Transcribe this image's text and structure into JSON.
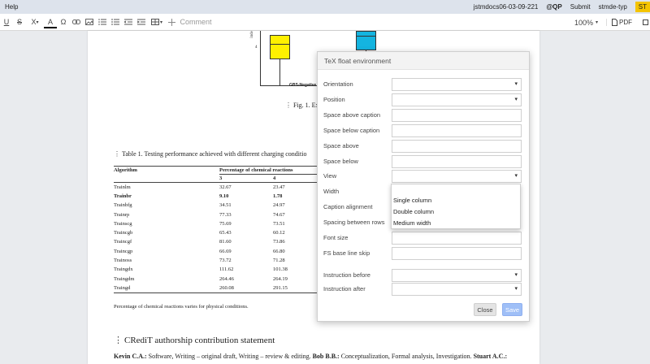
{
  "menubar": {
    "help": "Help",
    "doc_id": "jstmdocs06-03-09-221",
    "user": "@QP",
    "submit": "Submit",
    "template": "stmde-typ",
    "badge": "ST"
  },
  "toolbar": {
    "underline": "U",
    "strike": "S",
    "subsup": "X",
    "textcolor": "A",
    "special": "Ω",
    "comment": "Comment",
    "zoom": "100%",
    "pdf": "PDF"
  },
  "figure": {
    "y_axis_label": "inde",
    "y_tick": "4",
    "x_tick": "GBS-Negative",
    "caption": "Fig. 1. Ex"
  },
  "table": {
    "caption": "Table 1. Testing performance achieved with different charging conditio",
    "header_col1": "Algorithm",
    "header_group": "Percentage of chemical reactions",
    "sub_col2": "3",
    "sub_col3": "4",
    "rows": [
      {
        "name": "Trainlm",
        "v3": "32.67",
        "v4": "23.47",
        "bold": false
      },
      {
        "name": "Trainbr",
        "v3": "9.10",
        "v4": "1.78",
        "bold": true
      },
      {
        "name": "Trainbfg",
        "v3": "34.51",
        "v4": "24.97",
        "bold": false
      },
      {
        "name": "Trainrp",
        "v3": "77.33",
        "v4": "74.67",
        "bold": false
      },
      {
        "name": "Trainscg",
        "v3": "75.69",
        "v4": "73.51",
        "bold": false
      },
      {
        "name": "Traincgb",
        "v3": "65.43",
        "v4": "60.12",
        "bold": false
      },
      {
        "name": "Traincgf",
        "v3": "81.60",
        "v4": "73.86",
        "bold": false
      },
      {
        "name": "Traincgp",
        "v3": "66.69",
        "v4": "66.80",
        "bold": false
      },
      {
        "name": "Trainoss",
        "v3": "73.72",
        "v4": "71.28",
        "bold": false
      },
      {
        "name": "Traingdx",
        "v3": "111.62",
        "v4": "101.38",
        "bold": false
      },
      {
        "name": "Traingdm",
        "v3": "264.46",
        "v4": "264.19",
        "bold": false
      },
      {
        "name": "Traingd",
        "v3": "260.08",
        "v4": "291.15",
        "bold": false
      }
    ],
    "note": "Percentage of chemical reactions varies for physical conditions."
  },
  "section": {
    "title": "CRediT authorship contribution statement",
    "name1": "Kevin C.A.:",
    "text1": " Software, Writing – original draft, Writing – review & editing. ",
    "name2": "Bob B.B.:",
    "text2": " Conceptualization, Formal analysis, Investigation. ",
    "name3": "Stuart A.C.:"
  },
  "dialog": {
    "title": "TeX float environment",
    "fields": {
      "orientation": "Orientation",
      "position": "Position",
      "space_above_caption": "Space above caption",
      "space_below_caption": "Space below caption",
      "space_above": "Space above",
      "space_below": "Space below",
      "view": "View",
      "width": "Width",
      "caption_alignment": "Caption alignment",
      "spacing_between_rows": "Spacing between rows",
      "font_size": "Font size",
      "fs_base_line_skip": "FS base line skip",
      "instruction_before": "Instruction before",
      "instruction_after": "Instruction after"
    },
    "view_options": [
      "Single column",
      "Double column",
      "Medium width"
    ],
    "close": "Close",
    "save": "Save"
  },
  "colors": {
    "box_yellow": "#fff000",
    "box_blue": "#14b4e0",
    "badge": "#f4c400",
    "save_button": "#9fbff7"
  }
}
